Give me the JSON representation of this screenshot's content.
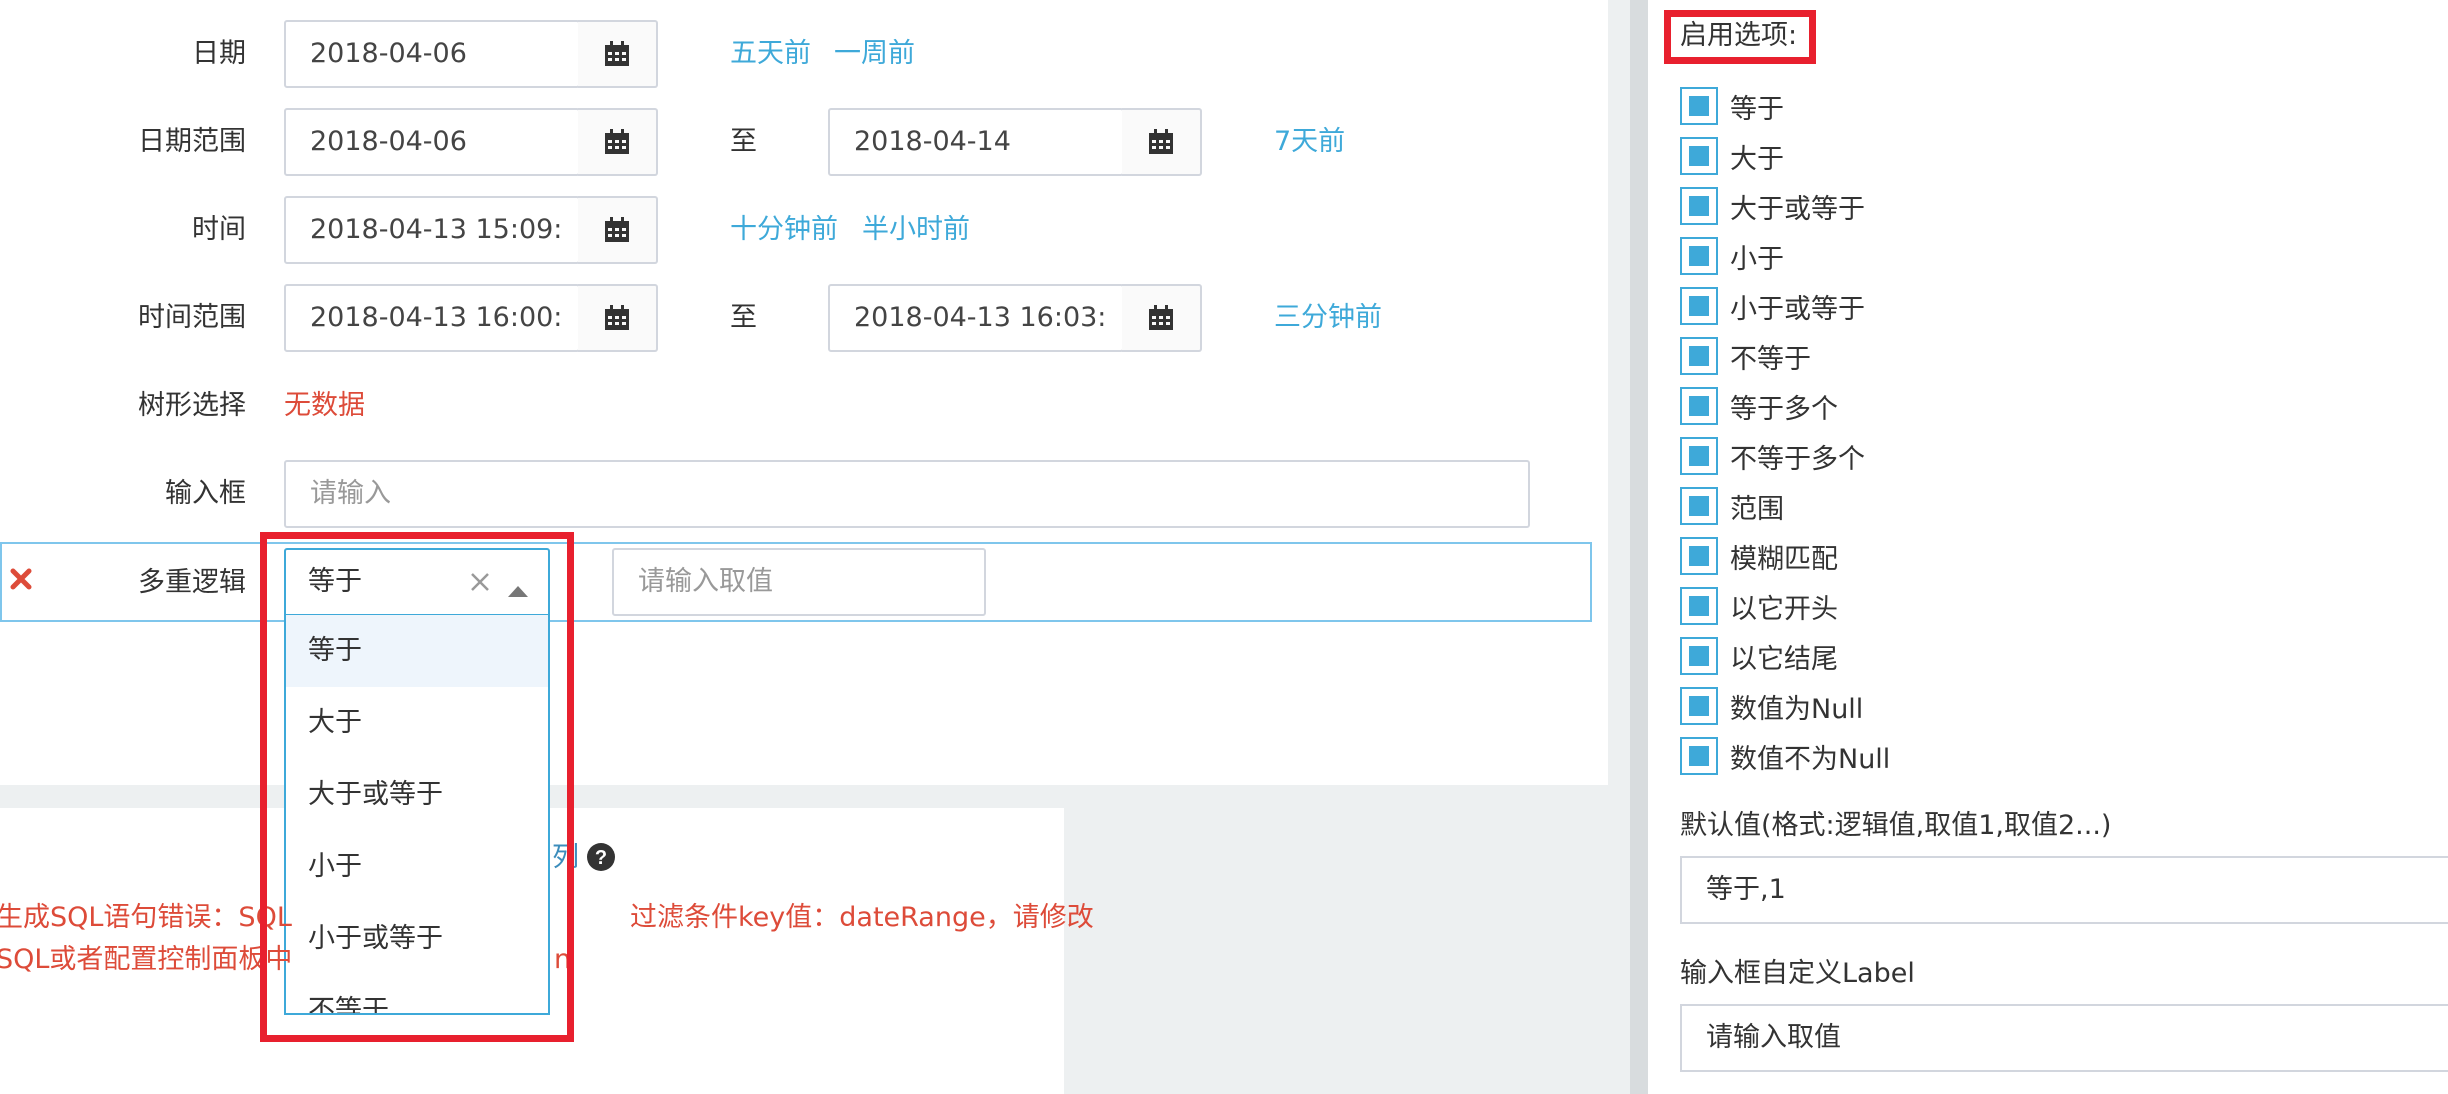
{
  "form": {
    "date": {
      "label": "日期",
      "value": "2018-04-06",
      "shortcuts": [
        "五天前",
        "一周前"
      ]
    },
    "date_range": {
      "label": "日期范围",
      "from": "2018-04-06",
      "to_label": "至",
      "to": "2018-04-14",
      "shortcut": "7天前"
    },
    "time": {
      "label": "时间",
      "value": "2018-04-13 15:09:",
      "shortcuts": [
        "十分钟前",
        "半小时前"
      ]
    },
    "time_range": {
      "label": "时间范围",
      "from": "2018-04-13 16:00:",
      "to_label": "至",
      "to": "2018-04-13 16:03:",
      "shortcut": "三分钟前"
    },
    "tree_select": {
      "label": "树形选择",
      "value": "无数据"
    },
    "input": {
      "label": "输入框",
      "placeholder": "请输入"
    },
    "multi_logic": {
      "label": "多重逻辑",
      "selected": "等于",
      "value_placeholder": "请输入取值",
      "options": [
        "等于",
        "大于",
        "大于或等于",
        "小于",
        "小于或等于",
        "不等于"
      ]
    }
  },
  "error": {
    "example_link_fragment": "列",
    "line1_start": "生成SQL语句错误：SQL",
    "line1_end": "过滤条件key值：dateRange，请修改",
    "line2_start": "SQL或者配置控制面板中",
    "line2_end": "n"
  },
  "settings": {
    "enable_options_label": "启用选项:",
    "options": [
      "等于",
      "大于",
      "大于或等于",
      "小于",
      "小于或等于",
      "不等于",
      "等于多个",
      "不等于多个",
      "范围",
      "模糊匹配",
      "以它开头",
      "以它结尾",
      "数值为Null",
      "数值不为Null"
    ],
    "default_value_label": "默认值(格式:逻辑值,取值1,取值2...)",
    "default_value": "等于,1",
    "custom_label_label": "输入框自定义Label",
    "custom_label_value": "请输入取值"
  },
  "colors": {
    "accent": "#3ea9d9",
    "link": "#3c8dbc",
    "error": "#dd4b39",
    "highlight_frame": "#e8202e"
  }
}
